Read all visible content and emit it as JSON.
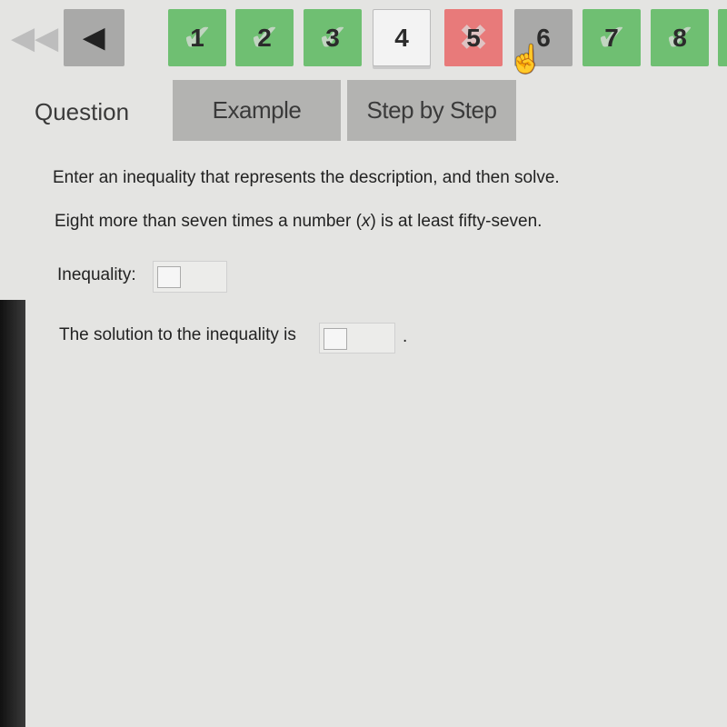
{
  "nav": {
    "first_icon": "double-chevron-left-icon",
    "prev_icon": "triangle-left-icon",
    "questions": [
      {
        "label": "1",
        "status": "correct"
      },
      {
        "label": "2",
        "status": "correct"
      },
      {
        "label": "3",
        "status": "correct"
      },
      {
        "label": "4",
        "status": "current"
      },
      {
        "label": "5",
        "status": "incorrect"
      },
      {
        "label": "6",
        "status": "unanswered"
      },
      {
        "label": "7",
        "status": "correct"
      },
      {
        "label": "8",
        "status": "correct"
      }
    ],
    "colors": {
      "correct": "#6fbf72",
      "incorrect": "#e87a7a",
      "unanswered": "#a9a9a8",
      "current": "#f3f3f3"
    }
  },
  "tabs": {
    "question": "Question",
    "example": "Example",
    "step": "Step by Step"
  },
  "content": {
    "instruction": "Enter an inequality that represents the description, and then solve.",
    "problem_before": "Eight more than seven times a number (",
    "problem_var": "x",
    "problem_after": ") is at least fifty-seven.",
    "inequality_label": "Inequality:",
    "solution_label": "The solution to the inequality is",
    "period": "."
  }
}
